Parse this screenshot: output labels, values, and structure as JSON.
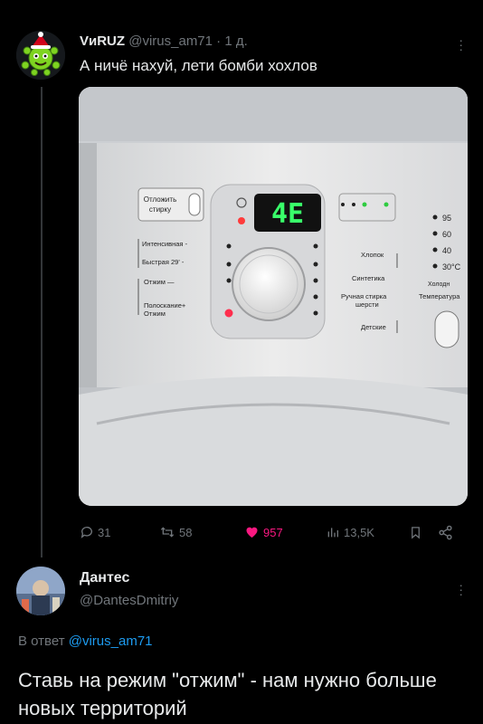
{
  "tweet": {
    "author_name": "VиRUZ",
    "author_handle": "@virus_am71",
    "separator": " · ",
    "time": "1 д.",
    "text": "А ничё нахуй, лети бомби хохлов",
    "actions": {
      "replies": "31",
      "retweets": "58",
      "likes": "957",
      "views": "13,5K"
    }
  },
  "machine_panel": {
    "delay_label": "Отложить стирку",
    "display_value": "4E",
    "left_labels": [
      "Интенсивная",
      "Быстрая 29'",
      "Отжим",
      "Полоскание+ Отжим"
    ],
    "right_labels": [
      "Хлопок",
      "Синтетика",
      "Ручная стирка шерсти",
      "Детские"
    ],
    "temps": [
      "95",
      "60",
      "40",
      "30°C",
      "Холодн"
    ],
    "temp_label": "Температура"
  },
  "reply": {
    "author_name": "Дантес",
    "author_handle": "@DantesDmitriy",
    "reply_prefix": "В ответ ",
    "reply_to": "@virus_am71",
    "text": "Ставь на режим \"отжим\" - нам нужно больше новых территорий"
  },
  "colors": {
    "background": "#000000",
    "text": "#e7e9ea",
    "muted": "#71767b",
    "link": "#1d9bf0",
    "like": "#f91880",
    "display_green": "#39ff6a"
  }
}
